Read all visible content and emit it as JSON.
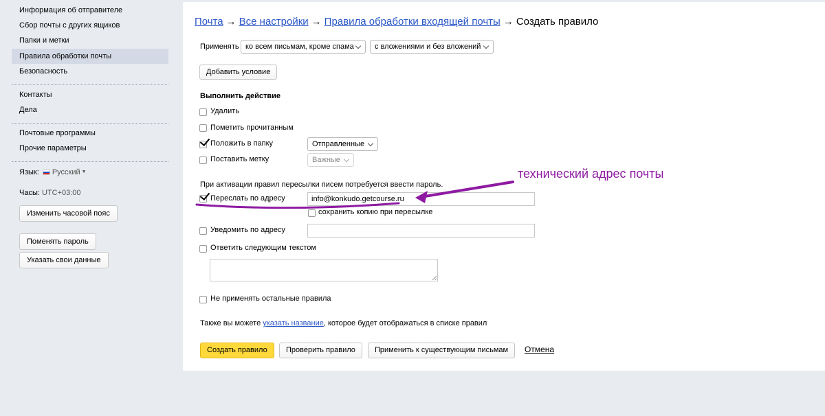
{
  "sidebar": {
    "items": [
      {
        "label": "Информация об отправителе"
      },
      {
        "label": "Сбор почты с других ящиков"
      },
      {
        "label": "Папки и метки"
      },
      {
        "label": "Правила обработки почты",
        "active": true
      },
      {
        "label": "Безопасность"
      },
      {
        "label": "Контакты"
      },
      {
        "label": "Дела"
      },
      {
        "label": "Почтовые программы"
      },
      {
        "label": "Прочие параметры"
      }
    ],
    "language_label": "Язык:",
    "language_value": "Русский",
    "clock_label": "Часы:",
    "clock_value": "UTC+03:00",
    "change_timezone_button": "Изменить часовой пояс",
    "change_password_button": "Поменять пароль",
    "specify_data_button": "Указать свои данные"
  },
  "breadcrumbs": {
    "mail": "Почта",
    "all_settings": "Все настройки",
    "rules": "Правила обработки входящей почты",
    "current": "Создать правило",
    "separator": "→"
  },
  "apply": {
    "label": "Применять",
    "scope_value": "ко всем письмам, кроме спама",
    "attachments_value": "с вложениями и без вложений"
  },
  "add_condition_button": "Добавить условие",
  "actions": {
    "heading": "Выполнить действие",
    "delete": {
      "label": "Удалить",
      "checked": false
    },
    "mark_read": {
      "label": "Пометить прочитанным",
      "checked": false
    },
    "move_folder": {
      "label": "Положить в папку",
      "checked": true,
      "folder_value": "Отправленные"
    },
    "set_label": {
      "label": "Поставить метку",
      "checked": false,
      "label_value": "Важные"
    },
    "forward_notice": "При активации правил пересылки писем потребуется ввести пароль.",
    "forward": {
      "label": "Переслать по адресу",
      "checked": true,
      "address_value": "info@konkudo.getcourse.ru"
    },
    "keep_copy": {
      "label": "сохранить копию при пересылке",
      "checked": false
    },
    "notify": {
      "label": "Уведомить по адресу",
      "checked": false,
      "address_value": ""
    },
    "reply": {
      "label": "Ответить следующим текстом",
      "checked": false,
      "text_value": ""
    },
    "no_other_rules": {
      "label": "Не применять остальные правила",
      "checked": false
    }
  },
  "name_hint": {
    "prefix": "Также вы можете ",
    "link": "указать название",
    "suffix": ", которое будет отображаться в списке правил"
  },
  "footer": {
    "create_button": "Создать правило",
    "check_button": "Проверить правило",
    "apply_existing_button": "Применить к существующим письмам",
    "cancel_link": "Отмена"
  },
  "annotation": {
    "text": "технический адрес почты",
    "color": "#8e1aa2"
  },
  "colors": {
    "primary_button": "#ffd93b",
    "link": "#2a56c6",
    "sidebar_active": "#d4dae5",
    "background": "#e8ebf0"
  }
}
